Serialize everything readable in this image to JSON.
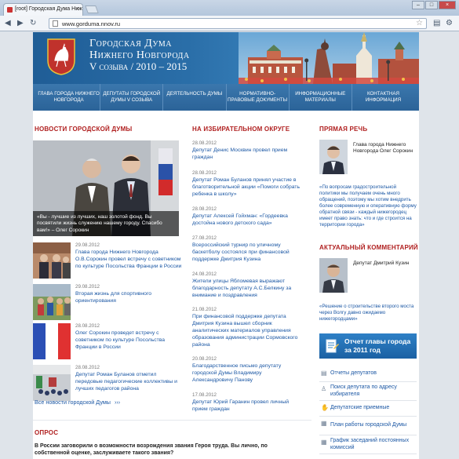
{
  "browser": {
    "tab_title": "[root] Городская Дума Ниж",
    "tab_close": "×",
    "url": "www.gorduma.nnov.ru"
  },
  "header": {
    "line1": "Городская Дума",
    "line2": "Нижнего Новгорода",
    "line3": "V созыва / 2010 – 2015"
  },
  "menu": [
    "Глава города Нижнего Новгорода",
    "Депутаты городской Думы V созыва",
    "Деятельность Думы",
    "Нормативно-правовые документы",
    "Информационные материалы",
    "Контактная информация"
  ],
  "news": {
    "heading": "Новости городской Думы",
    "hero_caption": "«Вы - лучшие из лучших, наш золотой фонд. Вы посвятили жизнь служению нашему городу. Спасибо вам!» – Олег Сорокин",
    "items": [
      {
        "date": "29.08.2012",
        "title": "Глава города Нижнего Новгорода О.В.Сорокин провел встречу с советником по культуре Посольства Франции в России"
      },
      {
        "date": "29.08.2012",
        "title": "Вторая жизнь для спортивного ориентирования"
      },
      {
        "date": "28.08.2012",
        "title": "Олег Сорокин проведет встречу с советником по культуре Посольства Франции в России"
      },
      {
        "date": "28.08.2012",
        "title": "Депутат Роман Буланов отметил передовые педагогические коллективы и лучших педагогов района"
      }
    ],
    "all_link": "Все новости городской Думы",
    "all_arrow": "›››"
  },
  "district": {
    "heading": "На избирательном округе",
    "items": [
      {
        "date": "28.08.2012",
        "title": "Депутат Денис Москвин провел прием граждан"
      },
      {
        "date": "28.08.2012",
        "title": "Депутат Роман Буланов принял участие в благотворительной акции «Помоги собрать ребенка в школу»"
      },
      {
        "date": "28.08.2012",
        "title": "Депутат Алексей Гойхман: «Гордеевка достойна нового детского сада»"
      },
      {
        "date": "27.08.2012",
        "title": "Всероссийский турнир по уличному баскетболу состоялся при финансовой поддержке Дмитрия Кузина"
      },
      {
        "date": "24.08.2012",
        "title": "Жители улицы Ябломевая выражают благодарность депутату А.С.Белкину за внимание и поздравления"
      },
      {
        "date": "21.08.2012",
        "title": "При финансовой поддержке депутата Дмитрия Кузина вышел сборник аналитических материалов управления образования администрации Сормовского района"
      },
      {
        "date": "20.08.2012",
        "title": "Благодарственное письмо депутату городской Думы Владимиру Александровичу Панову"
      },
      {
        "date": "17.08.2012",
        "title": "Депутат Юрий Гаранин провел личный прием граждан"
      }
    ]
  },
  "direct": {
    "heading": "Прямая речь",
    "person": "Глава города Нижнего Новгорода Олег Сорокин",
    "quote": "«По вопросам градостроительной политики мы получаем очень много обращений, поэтому мы хотим внедрить более современную и оперативную форму обратной связи - каждый нижегородец имеет право знать: что и где строится на территории города»"
  },
  "comment": {
    "heading": "Актуальный комментарий",
    "person": "Депутат Дмитрий Кузин",
    "quote": "«Решение о строительстве второго моста через Волгу давно ожидаемо нижегородцами»"
  },
  "report_button": "Отчет главы города за 2011 год",
  "quick_links": [
    {
      "icon": "document-icon",
      "label": "Отчеты депутатов"
    },
    {
      "icon": "person-search-icon",
      "label": "Поиск депутата по адресу избирателя"
    },
    {
      "icon": "handshake-icon",
      "label": "Депутатские приемные"
    },
    {
      "icon": "calendar-icon",
      "label": "План работы городской Думы"
    },
    {
      "icon": "calendar-icon",
      "label": "График заседаний постоянных комиссий"
    }
  ],
  "poll": {
    "heading": "Опрос",
    "question": "В России заговорили о возможности возрождения звания Героя труда. Вы лично, по собственной оценке, заслуживаете такого звания?"
  },
  "colors": {
    "accent_red": "#b02020",
    "link_blue": "#1b57a4",
    "header_blue": "#1f5d96"
  }
}
